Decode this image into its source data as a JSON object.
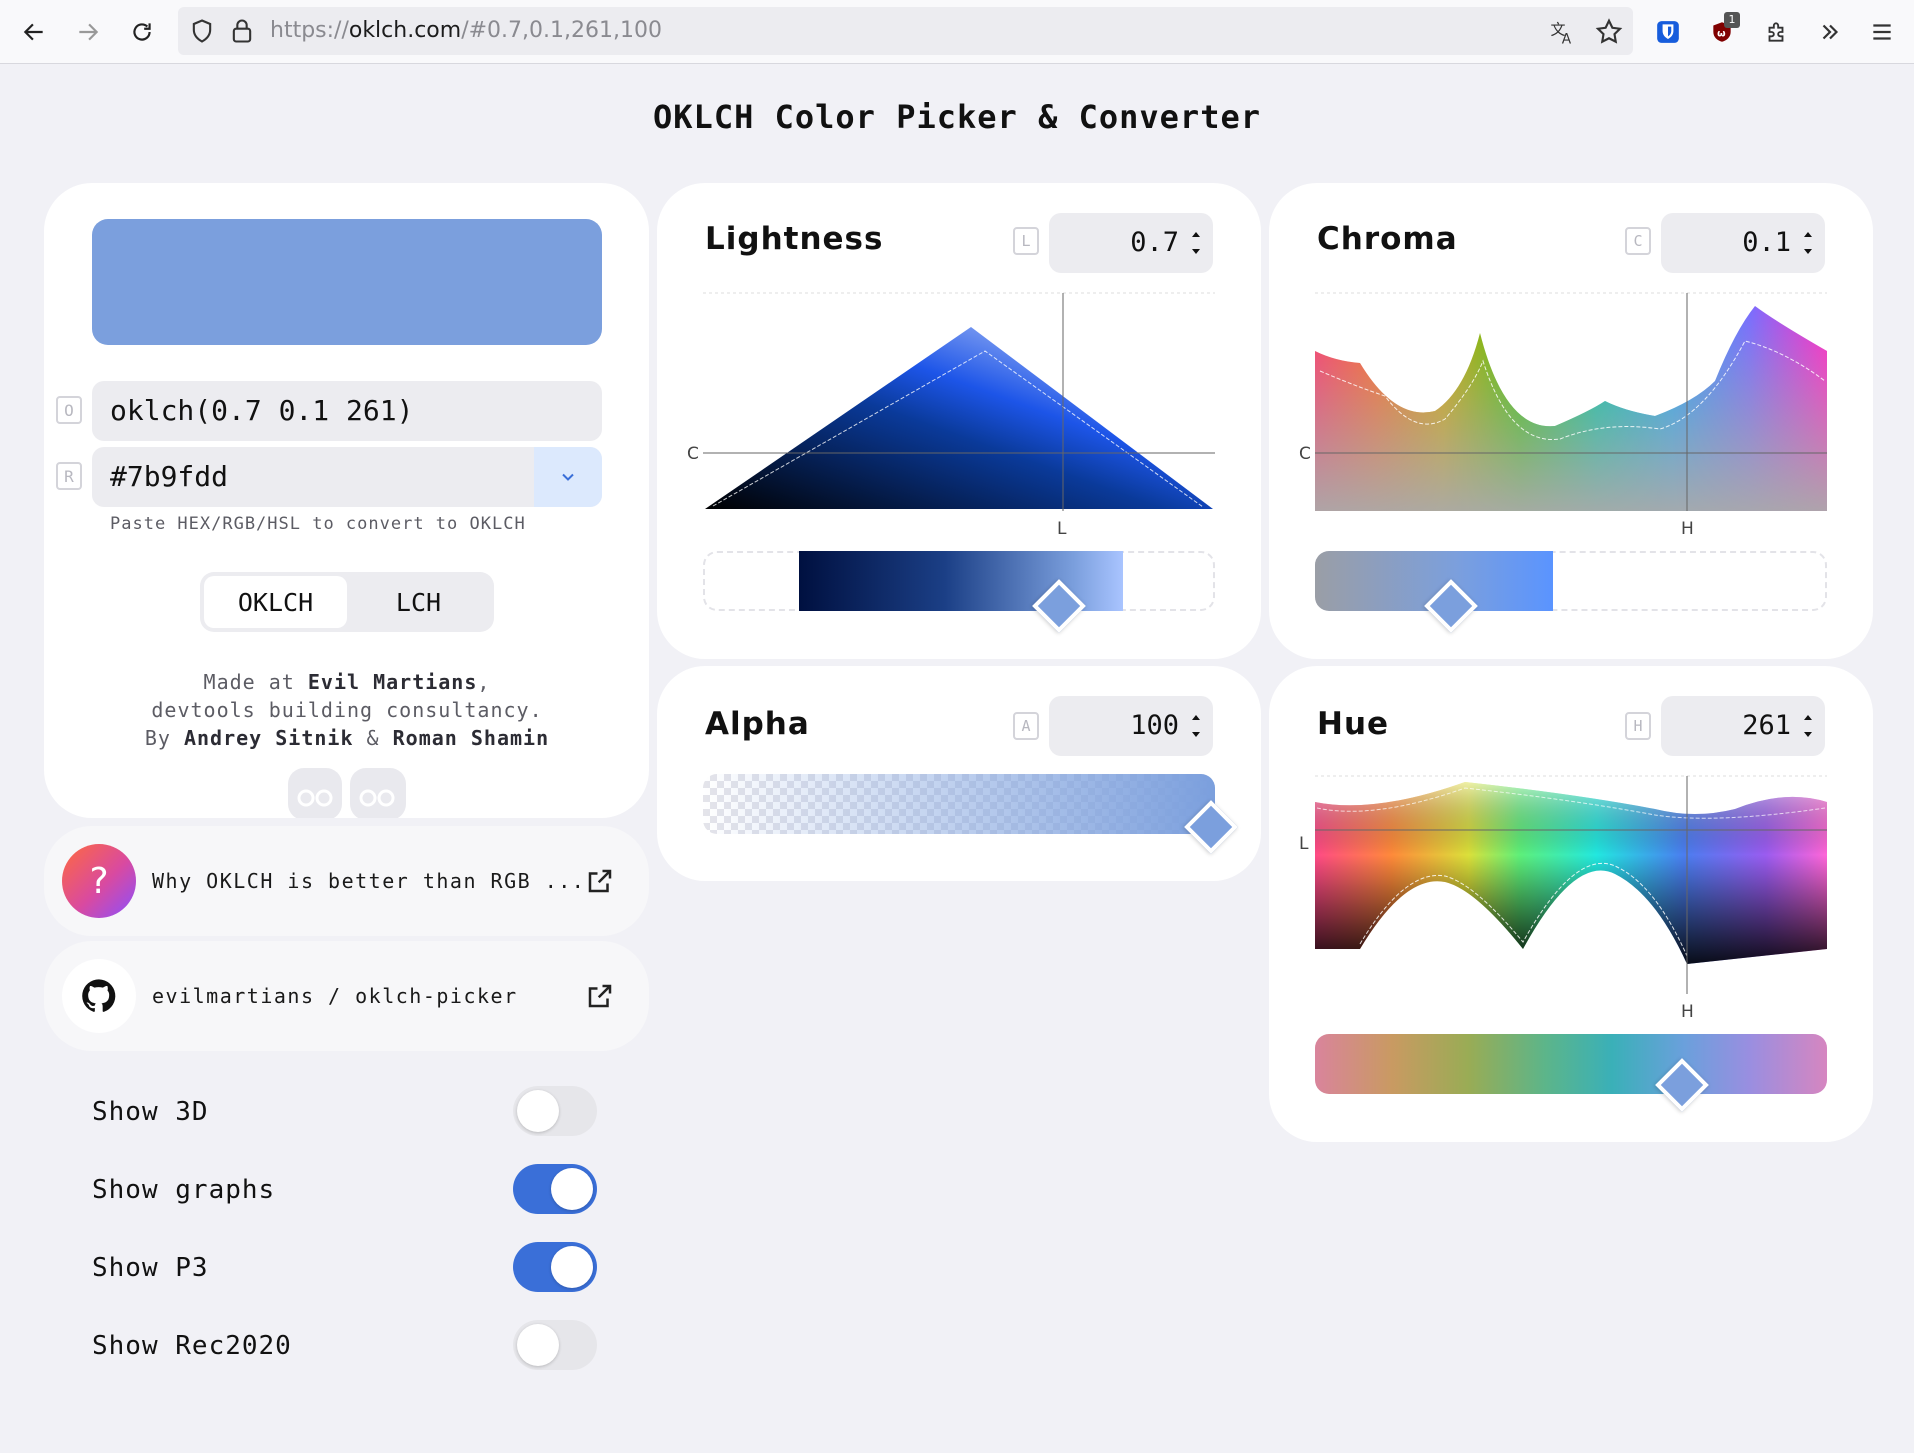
{
  "browser": {
    "url_prefix": "https://",
    "url_domain": "oklch.com",
    "url_rest": "/#0.7,0.1,261,100",
    "extension_badge": "1"
  },
  "page": {
    "title": "OKLCH Color Picker & Converter"
  },
  "picker": {
    "swatch_color": "#7b9fdd",
    "oklch_key": "O",
    "oklch_value": "oklch(0.7 0.1 261)",
    "rgb_key": "R",
    "rgb_value": "#7b9fdd",
    "hint": "Paste HEX/RGB/HSL to convert to OKLCH",
    "tabs": [
      {
        "label": "OKLCH",
        "active": true
      },
      {
        "label": "LCH",
        "active": false
      }
    ],
    "credits_line1_pre": "Made at ",
    "credits_line1_bold": "Evil Martians",
    "credits_line1_post": ",",
    "credits_line2": "devtools building consultancy.",
    "credits_line3_pre": "By ",
    "credits_author1": "Andrey Sitnik",
    "credits_amp": " & ",
    "credits_author2": "Roman Shamin"
  },
  "links": [
    {
      "icon": "question-icon",
      "label": "Why OKLCH is better than RGB ..."
    },
    {
      "icon": "github-icon",
      "label": "evilmartians / oklch-picker"
    }
  ],
  "settings": [
    {
      "label": "Show 3D",
      "on": false
    },
    {
      "label": "Show graphs",
      "on": true
    },
    {
      "label": "Show P3",
      "on": true
    },
    {
      "label": "Show Rec2020",
      "on": false
    }
  ],
  "controls": {
    "lightness": {
      "title": "Lightness",
      "key": "L",
      "value": "0.7",
      "axis_y": "C",
      "axis_x": "L",
      "level": 0.7
    },
    "chroma": {
      "title": "Chroma",
      "key": "C",
      "value": "0.1",
      "axis_y": "C",
      "axis_x": "H",
      "level": 0.1
    },
    "alpha": {
      "title": "Alpha",
      "key": "A",
      "value": "100",
      "level": 100
    },
    "hue": {
      "title": "Hue",
      "key": "H",
      "value": "261",
      "axis_y": "L",
      "axis_x": "H",
      "level": 261
    }
  },
  "colors": {
    "accent": "#3a6fd8",
    "swatch": "#7b9fdd",
    "dropdown_bg": "#dce9fd"
  }
}
